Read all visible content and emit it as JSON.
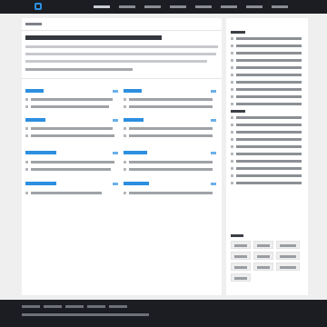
{
  "header": {
    "logo_text": "",
    "nav": [
      "",
      "",
      "",
      "",
      "",
      "",
      "",
      ""
    ]
  },
  "breadcrumb": "",
  "article": {
    "title": "",
    "paragraph_lines": [
      "",
      "",
      ""
    ],
    "bullet": ""
  },
  "sections": [
    {
      "title": "",
      "more": "",
      "items": [
        "",
        ""
      ]
    },
    {
      "title": "",
      "more": "",
      "items": [
        "",
        ""
      ]
    },
    {
      "title": "",
      "more": "",
      "items": [
        "",
        ""
      ]
    },
    {
      "title": "",
      "more": "",
      "items": [
        "",
        ""
      ]
    },
    {
      "title": "",
      "more": "",
      "items": [
        "",
        ""
      ]
    },
    {
      "title": "",
      "more": "",
      "items": [
        "",
        ""
      ]
    },
    {
      "title": "",
      "more": "",
      "items": [
        "",
        ""
      ]
    },
    {
      "title": "",
      "more": "",
      "items": [
        "",
        ""
      ]
    }
  ],
  "sidebar": {
    "block1": {
      "title": "",
      "items": [
        "",
        "",
        "",
        "",
        "",
        "",
        "",
        "",
        "",
        ""
      ]
    },
    "block2": {
      "title": "",
      "items": [
        "",
        "",
        "",
        "",
        "",
        "",
        "",
        "",
        "",
        ""
      ]
    },
    "tags": {
      "title": "",
      "items": [
        "",
        "",
        "",
        "",
        "",
        "",
        "",
        "",
        "",
        ""
      ]
    }
  },
  "footer": {
    "links": [
      "",
      "",
      "",
      "",
      "",
      ""
    ]
  },
  "colors": {
    "accent": "#2c8fe0",
    "header_bg": "#1b1d22",
    "page_bg": "#efefef"
  }
}
